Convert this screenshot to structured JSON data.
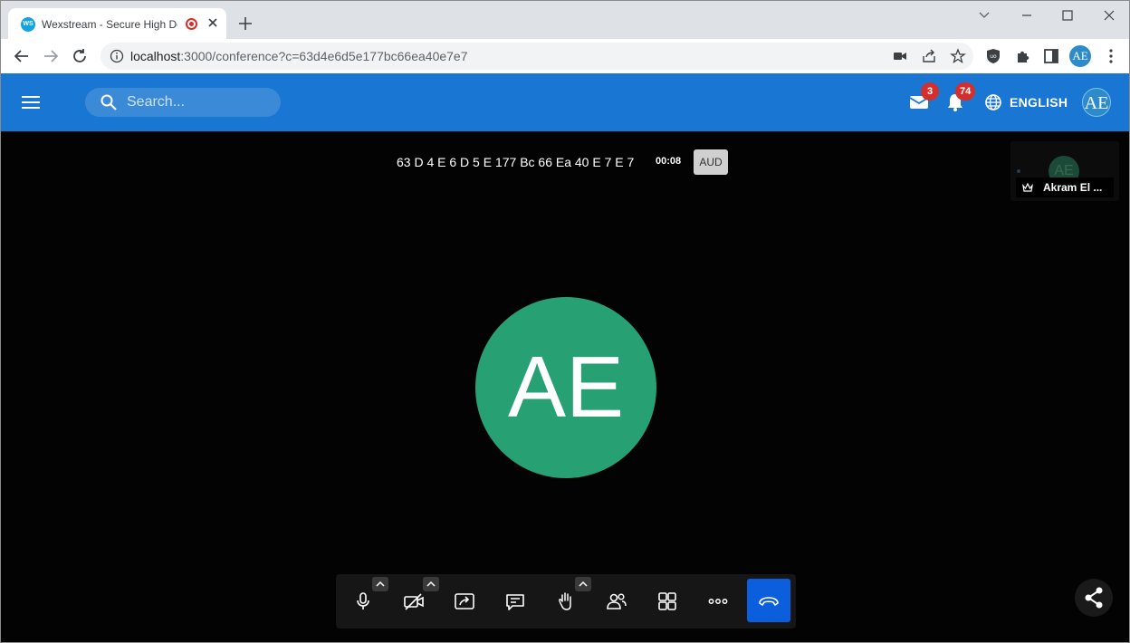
{
  "browser": {
    "tab": {
      "favicon_text": "WS",
      "title": "Wexstream - Secure High De"
    },
    "address": {
      "host": "localhost",
      "path": ":3000/conference?c=63d4e6d5e177bc66ea40e7e7"
    },
    "profile_initials": "AE"
  },
  "app": {
    "search_placeholder": "Search...",
    "messages_count": "3",
    "notifications_count": "74",
    "language": "ENGLISH",
    "avatar_initials": "AE",
    "brand_color": "#1976d2"
  },
  "conference": {
    "room_name": "63 D 4 E 6 D 5 E 177 Bc 66 Ea 40 E 7 E 7",
    "timer": "00:08",
    "audio_badge": "AUD",
    "main_avatar_initials": "AE",
    "avatar_color": "#27a074",
    "thumbnail": {
      "initials": "AE",
      "name": "Akram El ..."
    },
    "toolbar_icons": [
      "microphone-icon",
      "camera-off-icon",
      "screen-share-icon",
      "chat-icon",
      "raise-hand-icon",
      "participants-icon",
      "tile-view-icon",
      "more-icon",
      "hangup-icon"
    ]
  }
}
